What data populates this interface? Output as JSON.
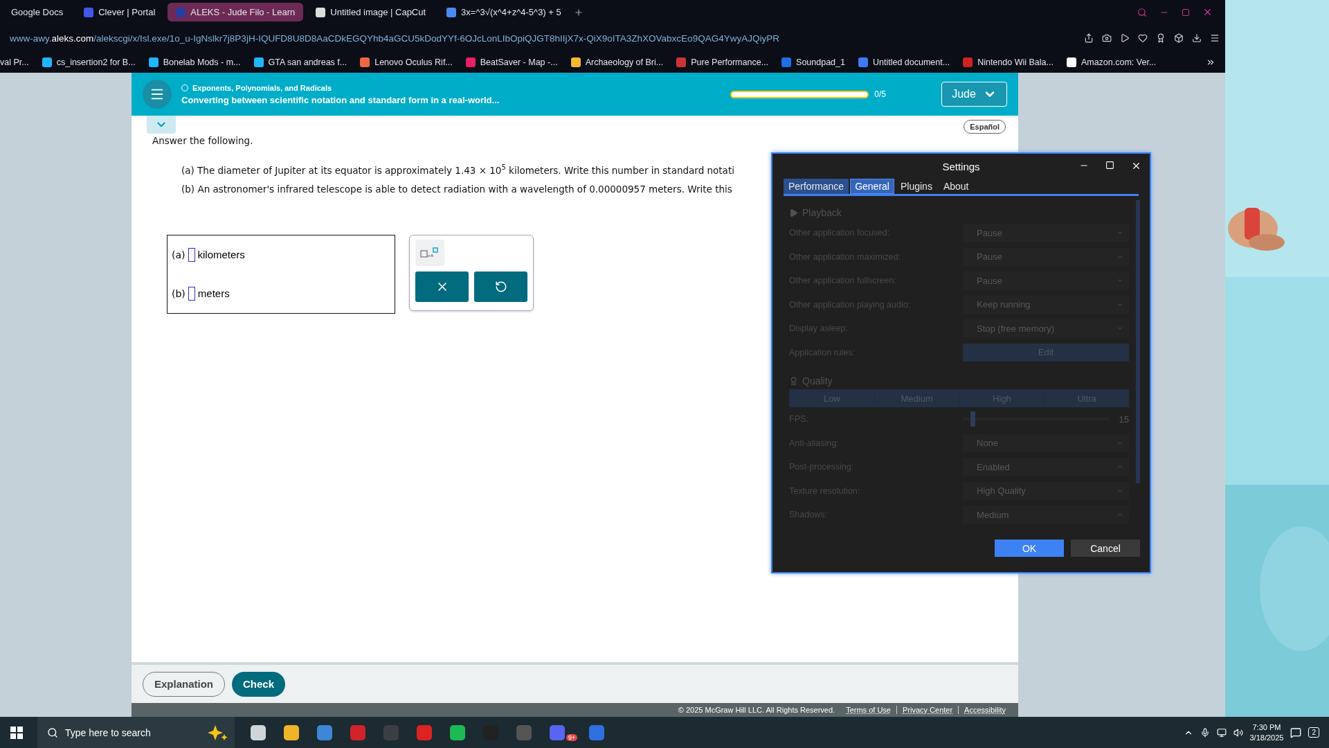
{
  "browser": {
    "tabs": [
      {
        "label": "Google Docs",
        "selected": false
      },
      {
        "label": "Clever | Portal",
        "selected": false
      },
      {
        "label": "ALEKS - Jude Filo - Learn",
        "selected": true
      },
      {
        "label": "Untitled image | CapCut",
        "selected": false
      },
      {
        "label": "3x=^3√(x^4+z^4-5^3) + 5",
        "selected": false
      }
    ],
    "url": "www-awy.**aleks.com**/alekscgi/x/Isl.exe/1o_u-IgNslkr7j8P3jH-IQUFD8U8D8AaCDkEGQYhb4aGCU5kDodYYf-6OJcLonLIbOpiQJGT8hIIjX7x-QiX9oITA3ZhXOVabxcEo9QAG4YwyAJQiyPR",
    "bookmarks": [
      "val Pr...",
      "cs_insertion2 for B...",
      "Bonelab Mods - m...",
      "GTA san andreas f...",
      "Lenovo Oculus Rif...",
      "BeatSaver - Map -...",
      "Archaeology of Bri...",
      "Pure Performance...",
      "Soundpad_1",
      "Untitled document...",
      "Nintendo Wii Bala...",
      "Amazon.com: Ver..."
    ]
  },
  "aleks": {
    "topic": "Exponents, Polynomials, and Radicals",
    "title": "Converting between scientific notation and standard form in a real-world...",
    "progress": {
      "level": 0,
      "reading": "0/5"
    },
    "user": "Jude",
    "language_button": "Español",
    "prompt": "Answer the following.",
    "questions": [
      "(a) The diameter of Jupiter at its equator is approximately 1.43 × 10$^{5}$  kilometers. Write this number in standard notati",
      "(b) An astronomer's infrared telescope is able to detect radiation with a wavelength of 0.00000957 meters. Write this"
    ],
    "answers": [
      {
        "label": "(a)",
        "unit": "kilometers"
      },
      {
        "label": "(b)",
        "unit": "meters"
      }
    ],
    "buttons": [
      {
        "label": "Explanation",
        "kind": "outline"
      },
      {
        "label": "Check",
        "kind": "primary"
      }
    ],
    "footer": {
      "copyright": "© 2025 McGraw Hill LLC. All Rights Reserved.",
      "links": [
        "Terms of Use",
        "Privacy Center",
        "Accessibility"
      ]
    }
  },
  "settings": {
    "title": "Settings",
    "disabled": true,
    "tabs": [
      {
        "label": "Performance",
        "selected": false
      },
      {
        "label": "General",
        "selected": true
      },
      {
        "label": "Plugins",
        "selected": false
      },
      {
        "label": "About",
        "selected": false
      }
    ],
    "playback": {
      "title": "Playback",
      "rows": [
        {
          "label": "Other application focused:",
          "kind": "select",
          "value": "Pause"
        },
        {
          "label": "Other application maximized:",
          "kind": "select",
          "value": "Pause"
        },
        {
          "label": "Other application fullscreen:",
          "kind": "select",
          "value": "Pause"
        },
        {
          "label": "Other application playing audio:",
          "kind": "select",
          "value": "Keep running"
        },
        {
          "label": "Display asleep:",
          "kind": "select",
          "value": "Stop (free memory)"
        },
        {
          "label": "Application rules:",
          "kind": "button",
          "value": "Edit"
        }
      ]
    },
    "quality": {
      "title": "Quality",
      "presets": [
        "Low",
        "Medium",
        "High",
        "Ultra"
      ],
      "rows": [
        {
          "label": "FPS:",
          "kind": "slider",
          "level": 0.05,
          "value": "15"
        },
        {
          "label": "Anti-aliasing:",
          "kind": "select_up",
          "value": "None"
        },
        {
          "label": "Post-processing:",
          "kind": "select_up",
          "value": "Enabled"
        },
        {
          "label": "Texture resolution:",
          "kind": "select_up",
          "value": "High Quality"
        },
        {
          "label": "Shadows:",
          "kind": "select_up",
          "value": "Medium"
        }
      ]
    },
    "buttons": [
      {
        "label": "OK",
        "kind": "primary"
      },
      {
        "label": "Cancel",
        "kind": "secondary"
      }
    ]
  },
  "taskbar": {
    "search_placeholder": "Type here to search",
    "badge": "9+",
    "time": "7:30 PM",
    "date": "3/18/2025",
    "notifications": "2"
  }
}
